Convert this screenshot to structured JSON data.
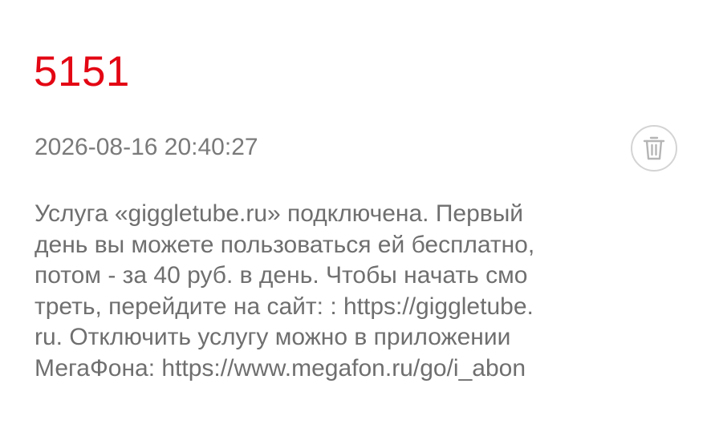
{
  "message": {
    "sender": "5151",
    "timestamp": "2026-08-16 20:40:27",
    "body": "Услуга «giggletube.ru» подключена. Первый\nдень вы можете пользоваться ей бесплатно,\nпотом - за 40 руб. в день. Чтобы начать смо\nтреть, перейдите на сайт: : https://giggletube.\nru. Отключить услугу можно в приложении\nМегаФона: https://www.megafon.ru/go/i_abon"
  },
  "actions": {
    "delete_icon": "trash-icon"
  },
  "colors": {
    "sender": "#e30613",
    "timestamp": "#7a7a7a",
    "body": "#6f6f6f",
    "delete_border": "#d4d4d4",
    "delete_icon": "#b5b5b5"
  }
}
